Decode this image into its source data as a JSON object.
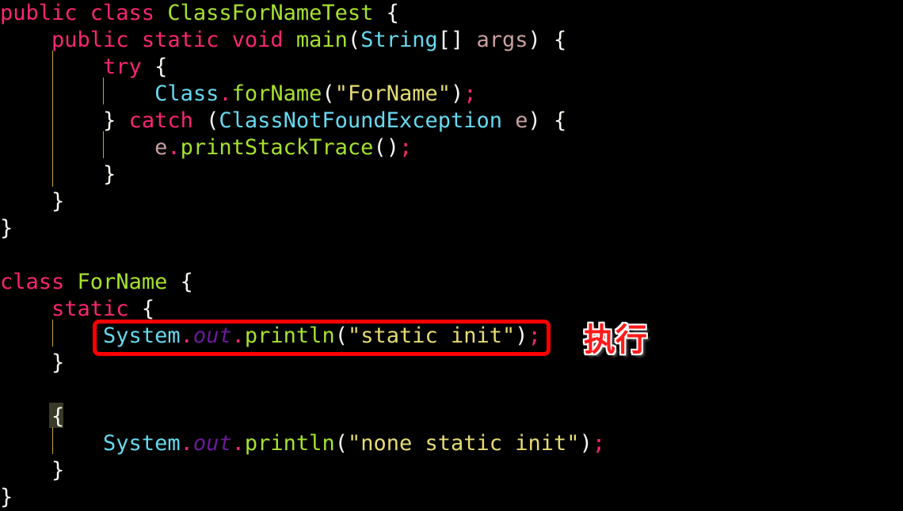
{
  "colors": {
    "keyword": "#f92672",
    "type": "#66d9ef",
    "function": "#a6e22e",
    "string": "#e6db74",
    "param": "#c9a0a0",
    "field_italic": "#6b1a99",
    "plain": "#f8f8f2",
    "guide": "#c9a227",
    "annotation": "#ff1a1a"
  },
  "annotation": {
    "label": "执行"
  },
  "lines": [
    [
      [
        "public class ",
        "keyword"
      ],
      [
        "ClassForNameTest",
        "function"
      ],
      [
        " {",
        "plain"
      ]
    ],
    [
      [
        "    ",
        "plain"
      ],
      [
        "public static void ",
        "keyword"
      ],
      [
        "main",
        "function"
      ],
      [
        "(",
        "plain"
      ],
      [
        "String",
        "type"
      ],
      [
        "[] ",
        "plain"
      ],
      [
        "args",
        "param"
      ],
      [
        ") {",
        "plain"
      ]
    ],
    [
      [
        "        ",
        "plain"
      ],
      [
        "try",
        "keyword"
      ],
      [
        " {",
        "plain"
      ]
    ],
    [
      [
        "            ",
        "plain"
      ],
      [
        "Class",
        "type"
      ],
      [
        ".",
        "keyword"
      ],
      [
        "forName",
        "function"
      ],
      [
        "(",
        "plain"
      ],
      [
        "\"ForName\"",
        "string"
      ],
      [
        ")",
        "plain"
      ],
      [
        ";",
        "keyword"
      ]
    ],
    [
      [
        "        } ",
        "plain"
      ],
      [
        "catch",
        "keyword"
      ],
      [
        " (",
        "plain"
      ],
      [
        "ClassNotFoundException",
        "type"
      ],
      [
        " ",
        "plain"
      ],
      [
        "e",
        "param"
      ],
      [
        ") {",
        "plain"
      ]
    ],
    [
      [
        "            ",
        "plain"
      ],
      [
        "e",
        "param"
      ],
      [
        ".",
        "keyword"
      ],
      [
        "printStackTrace",
        "function"
      ],
      [
        "()",
        "plain"
      ],
      [
        ";",
        "keyword"
      ]
    ],
    [
      [
        "        }",
        "plain"
      ]
    ],
    [
      [
        "    }",
        "plain"
      ]
    ],
    [
      [
        "}",
        "plain"
      ]
    ],
    [],
    [
      [
        "class ",
        "keyword"
      ],
      [
        "ForName",
        "function"
      ],
      [
        " {",
        "plain"
      ]
    ],
    [
      [
        "    ",
        "plain"
      ],
      [
        "static",
        "keyword"
      ],
      [
        " {",
        "plain"
      ]
    ],
    [
      [
        "        ",
        "plain"
      ],
      [
        "System",
        "type"
      ],
      [
        ".",
        "keyword"
      ],
      [
        "out",
        "field_italic"
      ],
      [
        ".",
        "keyword"
      ],
      [
        "println",
        "function"
      ],
      [
        "(",
        "plain"
      ],
      [
        "\"static init\"",
        "string"
      ],
      [
        ")",
        "plain"
      ],
      [
        ";",
        "keyword"
      ]
    ],
    [
      [
        "    }",
        "plain"
      ]
    ],
    [],
    [
      [
        "    {",
        "plain"
      ]
    ],
    [
      [
        "        ",
        "plain"
      ],
      [
        "System",
        "type"
      ],
      [
        ".",
        "keyword"
      ],
      [
        "out",
        "field_italic"
      ],
      [
        ".",
        "keyword"
      ],
      [
        "println",
        "function"
      ],
      [
        "(",
        "plain"
      ],
      [
        "\"none static init\"",
        "string"
      ],
      [
        ")",
        "plain"
      ],
      [
        ";",
        "keyword"
      ]
    ],
    [
      [
        "    }",
        "plain"
      ]
    ],
    [
      [
        "}",
        "plain"
      ]
    ]
  ]
}
